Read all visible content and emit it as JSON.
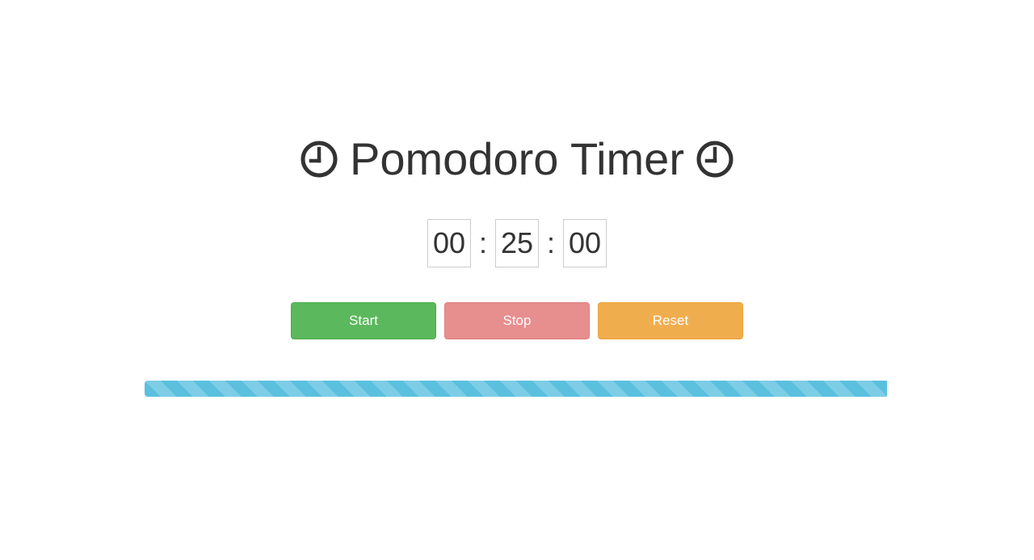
{
  "header": {
    "title": "Pomodoro Timer",
    "left_icon": "clock-icon",
    "right_icon": "clock-icon"
  },
  "timer": {
    "hours": "00",
    "minutes": "25",
    "seconds": "00",
    "separator": ":"
  },
  "controls": {
    "start_label": "Start",
    "stop_label": "Stop",
    "reset_label": "Reset"
  },
  "progress": {
    "value_fraction": 0.998,
    "style": "striped"
  },
  "colors": {
    "start": "#5cb85c",
    "stop": "#e78e8e",
    "reset": "#f0ad4e",
    "progress": "#5bc0de",
    "text": "#333333"
  }
}
